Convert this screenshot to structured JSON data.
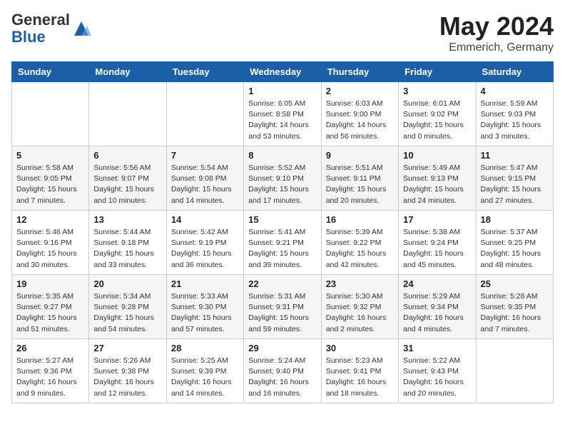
{
  "logo": {
    "general": "General",
    "blue": "Blue"
  },
  "header": {
    "month_year": "May 2024",
    "location": "Emmerich, Germany"
  },
  "weekdays": [
    "Sunday",
    "Monday",
    "Tuesday",
    "Wednesday",
    "Thursday",
    "Friday",
    "Saturday"
  ],
  "weeks": [
    [
      {
        "day": "",
        "info": ""
      },
      {
        "day": "",
        "info": ""
      },
      {
        "day": "",
        "info": ""
      },
      {
        "day": "1",
        "info": "Sunrise: 6:05 AM\nSunset: 8:58 PM\nDaylight: 14 hours\nand 53 minutes."
      },
      {
        "day": "2",
        "info": "Sunrise: 6:03 AM\nSunset: 9:00 PM\nDaylight: 14 hours\nand 56 minutes."
      },
      {
        "day": "3",
        "info": "Sunrise: 6:01 AM\nSunset: 9:02 PM\nDaylight: 15 hours\nand 0 minutes."
      },
      {
        "day": "4",
        "info": "Sunrise: 5:59 AM\nSunset: 9:03 PM\nDaylight: 15 hours\nand 3 minutes."
      }
    ],
    [
      {
        "day": "5",
        "info": "Sunrise: 5:58 AM\nSunset: 9:05 PM\nDaylight: 15 hours\nand 7 minutes."
      },
      {
        "day": "6",
        "info": "Sunrise: 5:56 AM\nSunset: 9:07 PM\nDaylight: 15 hours\nand 10 minutes."
      },
      {
        "day": "7",
        "info": "Sunrise: 5:54 AM\nSunset: 9:08 PM\nDaylight: 15 hours\nand 14 minutes."
      },
      {
        "day": "8",
        "info": "Sunrise: 5:52 AM\nSunset: 9:10 PM\nDaylight: 15 hours\nand 17 minutes."
      },
      {
        "day": "9",
        "info": "Sunrise: 5:51 AM\nSunset: 9:11 PM\nDaylight: 15 hours\nand 20 minutes."
      },
      {
        "day": "10",
        "info": "Sunrise: 5:49 AM\nSunset: 9:13 PM\nDaylight: 15 hours\nand 24 minutes."
      },
      {
        "day": "11",
        "info": "Sunrise: 5:47 AM\nSunset: 9:15 PM\nDaylight: 15 hours\nand 27 minutes."
      }
    ],
    [
      {
        "day": "12",
        "info": "Sunrise: 5:46 AM\nSunset: 9:16 PM\nDaylight: 15 hours\nand 30 minutes."
      },
      {
        "day": "13",
        "info": "Sunrise: 5:44 AM\nSunset: 9:18 PM\nDaylight: 15 hours\nand 33 minutes."
      },
      {
        "day": "14",
        "info": "Sunrise: 5:42 AM\nSunset: 9:19 PM\nDaylight: 15 hours\nand 36 minutes."
      },
      {
        "day": "15",
        "info": "Sunrise: 5:41 AM\nSunset: 9:21 PM\nDaylight: 15 hours\nand 39 minutes."
      },
      {
        "day": "16",
        "info": "Sunrise: 5:39 AM\nSunset: 9:22 PM\nDaylight: 15 hours\nand 42 minutes."
      },
      {
        "day": "17",
        "info": "Sunrise: 5:38 AM\nSunset: 9:24 PM\nDaylight: 15 hours\nand 45 minutes."
      },
      {
        "day": "18",
        "info": "Sunrise: 5:37 AM\nSunset: 9:25 PM\nDaylight: 15 hours\nand 48 minutes."
      }
    ],
    [
      {
        "day": "19",
        "info": "Sunrise: 5:35 AM\nSunset: 9:27 PM\nDaylight: 15 hours\nand 51 minutes."
      },
      {
        "day": "20",
        "info": "Sunrise: 5:34 AM\nSunset: 9:28 PM\nDaylight: 15 hours\nand 54 minutes."
      },
      {
        "day": "21",
        "info": "Sunrise: 5:33 AM\nSunset: 9:30 PM\nDaylight: 15 hours\nand 57 minutes."
      },
      {
        "day": "22",
        "info": "Sunrise: 5:31 AM\nSunset: 9:31 PM\nDaylight: 15 hours\nand 59 minutes."
      },
      {
        "day": "23",
        "info": "Sunrise: 5:30 AM\nSunset: 9:32 PM\nDaylight: 16 hours\nand 2 minutes."
      },
      {
        "day": "24",
        "info": "Sunrise: 5:29 AM\nSunset: 9:34 PM\nDaylight: 16 hours\nand 4 minutes."
      },
      {
        "day": "25",
        "info": "Sunrise: 5:28 AM\nSunset: 9:35 PM\nDaylight: 16 hours\nand 7 minutes."
      }
    ],
    [
      {
        "day": "26",
        "info": "Sunrise: 5:27 AM\nSunset: 9:36 PM\nDaylight: 16 hours\nand 9 minutes."
      },
      {
        "day": "27",
        "info": "Sunrise: 5:26 AM\nSunset: 9:38 PM\nDaylight: 16 hours\nand 12 minutes."
      },
      {
        "day": "28",
        "info": "Sunrise: 5:25 AM\nSunset: 9:39 PM\nDaylight: 16 hours\nand 14 minutes."
      },
      {
        "day": "29",
        "info": "Sunrise: 5:24 AM\nSunset: 9:40 PM\nDaylight: 16 hours\nand 16 minutes."
      },
      {
        "day": "30",
        "info": "Sunrise: 5:23 AM\nSunset: 9:41 PM\nDaylight: 16 hours\nand 18 minutes."
      },
      {
        "day": "31",
        "info": "Sunrise: 5:22 AM\nSunset: 9:43 PM\nDaylight: 16 hours\nand 20 minutes."
      },
      {
        "day": "",
        "info": ""
      }
    ]
  ]
}
